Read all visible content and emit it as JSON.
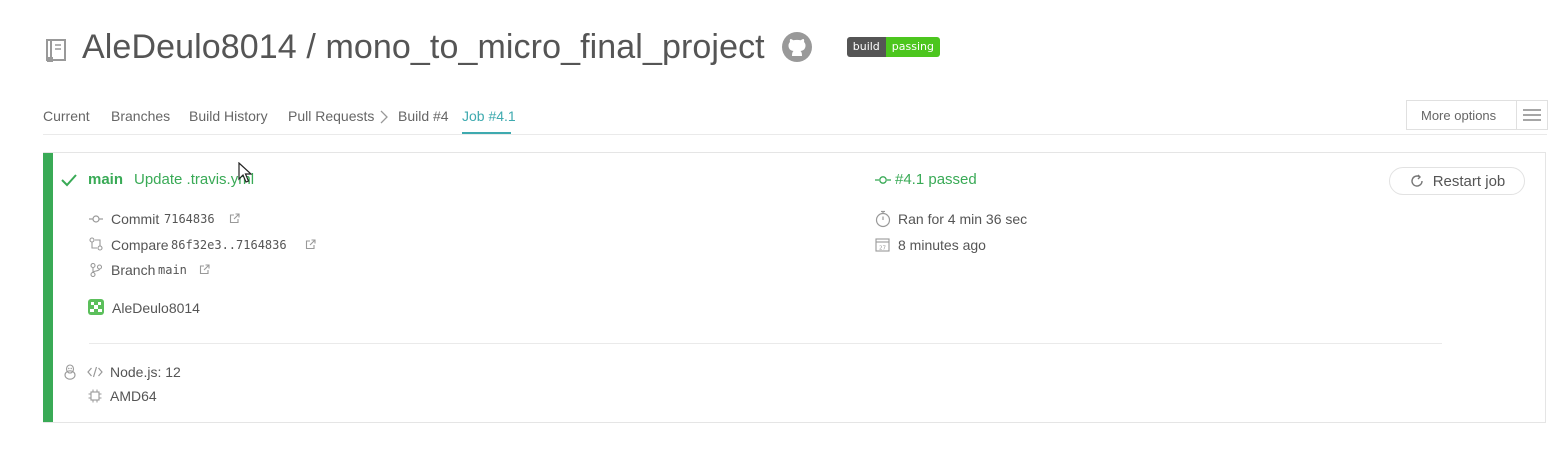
{
  "header": {
    "repo_title": "AleDeulo8014 / mono_to_micro_final_project",
    "badge_left": "build",
    "badge_right": "passing",
    "badge_left_color": "#555555",
    "badge_right_color": "#4cc61e"
  },
  "tabs": [
    {
      "label": "Current"
    },
    {
      "label": "Branches"
    },
    {
      "label": "Build History"
    },
    {
      "label": "Pull Requests"
    },
    {
      "label": "Build #4"
    },
    {
      "label": "Job #4.1"
    }
  ],
  "more_options": {
    "label": "More options"
  },
  "job": {
    "status_color": "#39aa56",
    "branch": "main",
    "message": "Update .travis.yml",
    "job_status": "#4.1 passed",
    "restart_label": "Restart job",
    "commit_label": "Commit",
    "commit_hash": "7164836",
    "compare_label": "Compare",
    "compare_range": "86f32e3..7164836",
    "branch_label": "Branch",
    "branch_name": "main",
    "ran_for": "Ran for 4 min 36 sec",
    "finished": "8 minutes ago",
    "author": "AleDeulo8014",
    "language": "Node.js: 12",
    "arch": "AMD64"
  },
  "icons": {
    "repo": "repo-icon",
    "github": "github-icon",
    "check": "check-icon",
    "commit": "commit-icon",
    "compare": "compare-icon",
    "branch": "branch-icon",
    "external": "external-link-icon",
    "stopwatch": "stopwatch-icon",
    "calendar": "calendar-icon",
    "avatar": "avatar",
    "linux": "linux-icon",
    "code": "code-icon",
    "cpu": "cpu-icon",
    "restart": "restart-icon",
    "menu": "hamburger-icon"
  }
}
